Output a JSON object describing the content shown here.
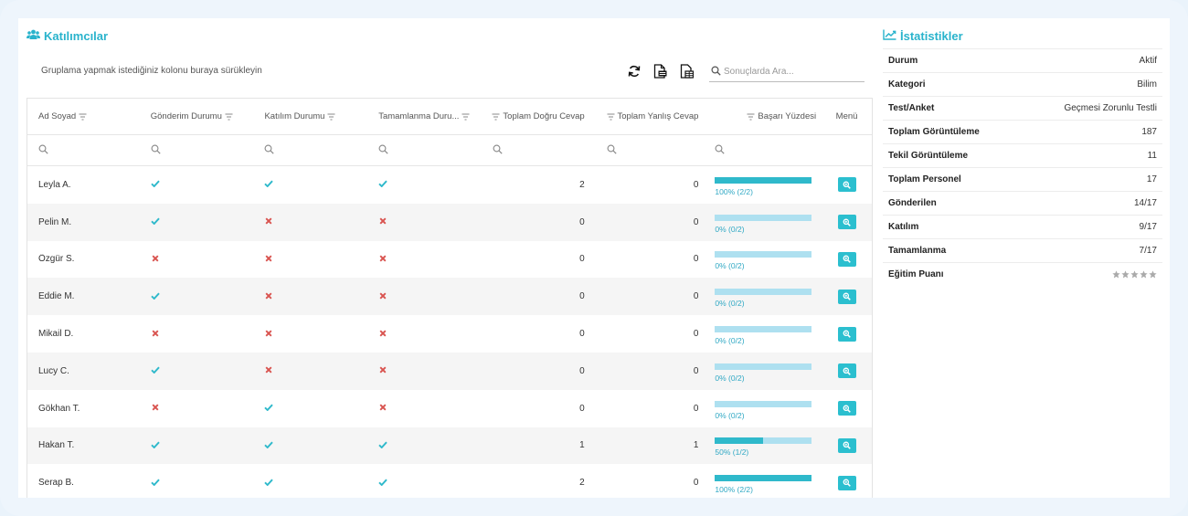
{
  "participants": {
    "title": "Katılımcılar",
    "group_hint": "Gruplama yapmak istediğiniz kolonu buraya sürükleyin",
    "toolbar": {
      "refresh_icon": "refresh-icon",
      "pdf_icon": "pdf-export-icon",
      "excel_icon": "excel-export-icon"
    },
    "search": {
      "placeholder": "Sonuçlarda Ara..."
    },
    "columns": [
      "Ad Soyad",
      "Gönderim Durumu",
      "Katılım Durumu",
      "Tamamlanma Duru...",
      "Toplam Doğru Cevap",
      "Toplam Yanlış Cevap",
      "Başarı Yüzdesi",
      "Menü"
    ],
    "rows": [
      {
        "name": "Leyla A.",
        "sent": true,
        "joined": true,
        "completed": true,
        "correct": "2",
        "wrong": "0",
        "success": 1.0,
        "success_label": "100% (2/2)"
      },
      {
        "name": "Pelin M.",
        "sent": true,
        "joined": false,
        "completed": false,
        "correct": "0",
        "wrong": "0",
        "success": 0.0,
        "success_label": "0% (0/2)"
      },
      {
        "name": "Özgür S.",
        "sent": false,
        "joined": false,
        "completed": false,
        "correct": "0",
        "wrong": "0",
        "success": 0.0,
        "success_label": "0% (0/2)"
      },
      {
        "name": "Eddie M.",
        "sent": true,
        "joined": false,
        "completed": false,
        "correct": "0",
        "wrong": "0",
        "success": 0.0,
        "success_label": "0% (0/2)"
      },
      {
        "name": "Mikail D.",
        "sent": false,
        "joined": false,
        "completed": false,
        "correct": "0",
        "wrong": "0",
        "success": 0.0,
        "success_label": "0% (0/2)"
      },
      {
        "name": "Lucy C.",
        "sent": true,
        "joined": false,
        "completed": false,
        "correct": "0",
        "wrong": "0",
        "success": 0.0,
        "success_label": "0% (0/2)"
      },
      {
        "name": "Gökhan T.",
        "sent": false,
        "joined": true,
        "completed": false,
        "correct": "0",
        "wrong": "0",
        "success": 0.0,
        "success_label": "0% (0/2)"
      },
      {
        "name": "Hakan T.",
        "sent": true,
        "joined": true,
        "completed": true,
        "correct": "1",
        "wrong": "1",
        "success": 0.5,
        "success_label": "50% (1/2)"
      },
      {
        "name": "Serap B.",
        "sent": true,
        "joined": true,
        "completed": true,
        "correct": "2",
        "wrong": "0",
        "success": 1.0,
        "success_label": "100% (2/2)"
      }
    ]
  },
  "stats": {
    "title": "İstatistikler",
    "rows": [
      {
        "label": "Durum",
        "value": "Aktif"
      },
      {
        "label": "Kategori",
        "value": "Bilim"
      },
      {
        "label": "Test/Anket",
        "value": "Geçmesi Zorunlu Testli"
      },
      {
        "label": "Toplam Görüntüleme",
        "value": "187"
      },
      {
        "label": "Tekil Görüntüleme",
        "value": "11"
      },
      {
        "label": "Toplam Personel",
        "value": "17"
      },
      {
        "label": "Gönderilen",
        "value": "14/17"
      },
      {
        "label": "Katılım",
        "value": "9/17"
      },
      {
        "label": "Tamamlanma",
        "value": "7/17"
      }
    ],
    "rating": {
      "label": "Eğitim Puanı",
      "value": 0,
      "max": 5
    }
  },
  "colors": {
    "accent": "#29b3cc",
    "check": "#2fb9cb",
    "cross": "#d9534f",
    "progress_fill": "#2fb9cb",
    "progress_track": "#aee0f0"
  }
}
